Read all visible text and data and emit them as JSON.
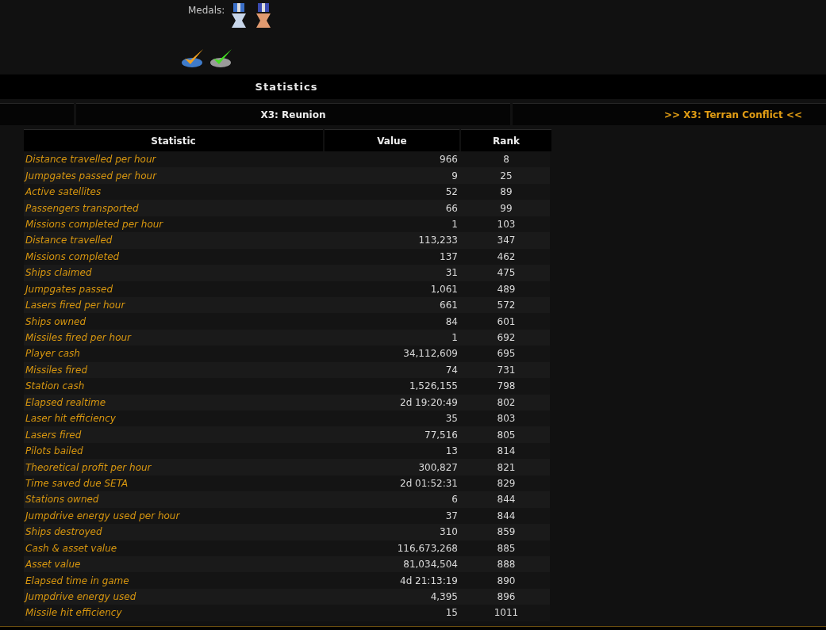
{
  "profile": {
    "medals_label": "Medals:"
  },
  "section_title": "Statistics",
  "tabs": [
    {
      "label": "X3: Reunion",
      "selected": true
    },
    {
      "label": ">> X3: Terran Conflict <<",
      "selected": false
    }
  ],
  "table": {
    "columns": [
      "Statistic",
      "Value",
      "Rank"
    ],
    "rows": [
      {
        "statistic": "Distance travelled per hour",
        "value": "966",
        "rank": "8"
      },
      {
        "statistic": "Jumpgates passed per hour",
        "value": "9",
        "rank": "25"
      },
      {
        "statistic": "Active satellites",
        "value": "52",
        "rank": "89"
      },
      {
        "statistic": "Passengers transported",
        "value": "66",
        "rank": "99"
      },
      {
        "statistic": "Missions completed per hour",
        "value": "1",
        "rank": "103"
      },
      {
        "statistic": "Distance travelled",
        "value": "113,233",
        "rank": "347"
      },
      {
        "statistic": "Missions completed",
        "value": "137",
        "rank": "462"
      },
      {
        "statistic": "Ships claimed",
        "value": "31",
        "rank": "475"
      },
      {
        "statistic": "Jumpgates passed",
        "value": "1,061",
        "rank": "489"
      },
      {
        "statistic": "Lasers fired per hour",
        "value": "661",
        "rank": "572"
      },
      {
        "statistic": "Ships owned",
        "value": "84",
        "rank": "601"
      },
      {
        "statistic": "Missiles fired per hour",
        "value": "1",
        "rank": "692"
      },
      {
        "statistic": "Player cash",
        "value": "34,112,609",
        "rank": "695"
      },
      {
        "statistic": "Missiles fired",
        "value": "74",
        "rank": "731"
      },
      {
        "statistic": "Station cash",
        "value": "1,526,155",
        "rank": "798"
      },
      {
        "statistic": "Elapsed realtime",
        "value": "2d 19:20:49",
        "rank": "802"
      },
      {
        "statistic": "Laser hit efficiency",
        "value": "35",
        "rank": "803"
      },
      {
        "statistic": "Lasers fired",
        "value": "77,516",
        "rank": "805"
      },
      {
        "statistic": "Pilots bailed",
        "value": "13",
        "rank": "814"
      },
      {
        "statistic": "Theoretical profit per hour",
        "value": "300,827",
        "rank": "821"
      },
      {
        "statistic": "Time saved due SETA",
        "value": "2d 01:52:31",
        "rank": "829"
      },
      {
        "statistic": "Stations owned",
        "value": "6",
        "rank": "844"
      },
      {
        "statistic": "Jumpdrive energy used per hour",
        "value": "37",
        "rank": "844"
      },
      {
        "statistic": "Ships destroyed",
        "value": "310",
        "rank": "859"
      },
      {
        "statistic": "Cash & asset value",
        "value": "116,673,268",
        "rank": "885"
      },
      {
        "statistic": "Asset value",
        "value": "81,034,504",
        "rank": "888"
      },
      {
        "statistic": "Elapsed time in game",
        "value": "4d 21:13:19",
        "rank": "890"
      },
      {
        "statistic": "Jumpdrive energy used",
        "value": "4,395",
        "rank": "896"
      },
      {
        "statistic": "Missile hit efficiency",
        "value": "15",
        "rank": "1011"
      }
    ]
  }
}
